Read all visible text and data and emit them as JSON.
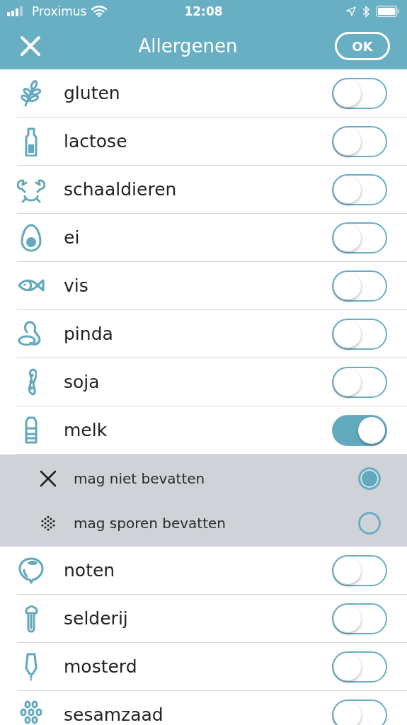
{
  "status_bar": {
    "carrier": "Proximus",
    "time": "12:08"
  },
  "nav": {
    "title": "Allergenen",
    "ok": "OK"
  },
  "items": [
    {
      "label": "gluten",
      "on": false
    },
    {
      "label": "lactose",
      "on": false
    },
    {
      "label": "schaaldieren",
      "on": false
    },
    {
      "label": "ei",
      "on": false
    },
    {
      "label": "vis",
      "on": false
    },
    {
      "label": "pinda",
      "on": false
    },
    {
      "label": "soja",
      "on": false
    },
    {
      "label": "melk",
      "on": true,
      "options": [
        {
          "label": "mag niet bevatten",
          "selected": true
        },
        {
          "label": "mag sporen bevatten",
          "selected": false
        }
      ]
    },
    {
      "label": "noten",
      "on": false
    },
    {
      "label": "selderij",
      "on": false
    },
    {
      "label": "mosterd",
      "on": false
    },
    {
      "label": "sesamzaad",
      "on": false
    }
  ]
}
